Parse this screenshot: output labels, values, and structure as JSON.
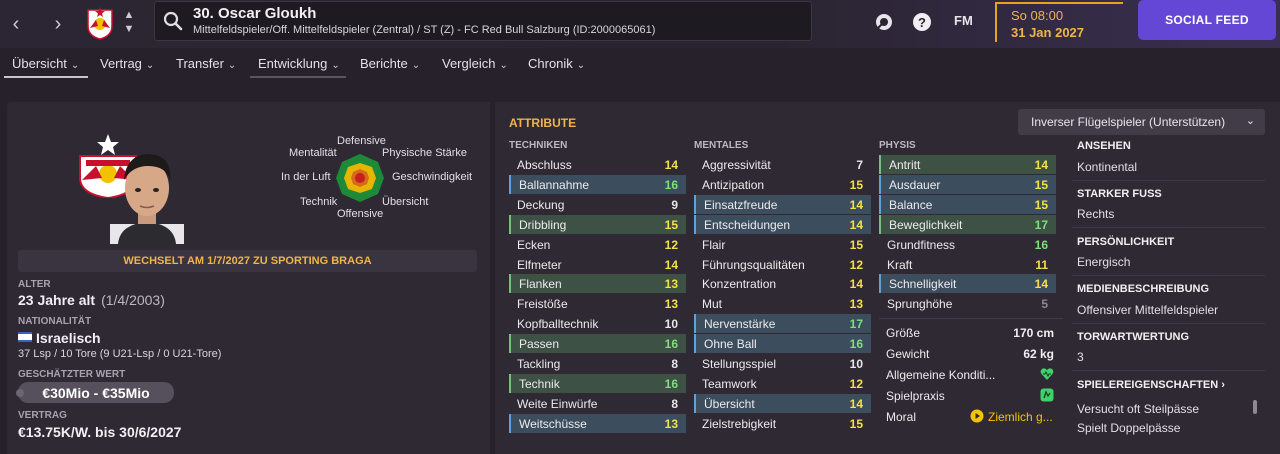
{
  "header": {
    "player_title": "30. Oscar Gloukh",
    "player_subtitle": "Mittelfeldspieler/Off. Mittelfeldspieler (Zentral) / ST (Z) - FC Red Bull Salzburg (ID:2000065061)",
    "fm_label": "FM",
    "date_day": "So 08:00",
    "date_date": "31 Jan 2027",
    "social_feed": "SOCIAL FEED"
  },
  "tabs": [
    {
      "label": "Übersicht"
    },
    {
      "label": "Vertrag"
    },
    {
      "label": "Transfer"
    },
    {
      "label": "Entwicklung"
    },
    {
      "label": "Berichte"
    },
    {
      "label": "Vergleich"
    },
    {
      "label": "Chronik"
    }
  ],
  "radar": {
    "labels": {
      "top": "Defensive",
      "top_left": "Mentalität",
      "top_right": "Physische Stärke",
      "left": "In der Luft",
      "right": "Geschwindigkeit",
      "bottom_left": "Technik",
      "bottom_right": "Übersicht",
      "bottom": "Offensive"
    }
  },
  "transfer_banner": "WECHSELT AM 1/7/2027 ZU SPORTING BRAGA",
  "info_left": {
    "age_label": "ALTER",
    "age_value": "23 Jahre alt",
    "age_dob": "(1/4/2003)",
    "nat_label": "NATIONALITÄT",
    "nat_value": "Israelisch",
    "apps": "37 Lsp / 10 Tore (9 U21-Lsp / 0 U21-Tore)",
    "value_label": "GESCHÄTZTER WERT",
    "value": "€30Mio - €35Mio",
    "contract_label": "VERTRAG",
    "contract_value": "€13.75K/W. bis 30/6/2027"
  },
  "attributes": {
    "title": "ATTRIBUTE",
    "role": "Inverser Flügelspieler (Unterstützen)",
    "tech_head": "TECHNIKEN",
    "mental_head": "MENTALES",
    "phys_head": "PHYSIS",
    "technical": [
      {
        "name": "Abschluss",
        "value": "14",
        "hl": ""
      },
      {
        "name": "Ballannahme",
        "value": "16",
        "hl": "b"
      },
      {
        "name": "Deckung",
        "value": "9",
        "hl": ""
      },
      {
        "name": "Dribbling",
        "value": "15",
        "hl": "g"
      },
      {
        "name": "Ecken",
        "value": "12",
        "hl": ""
      },
      {
        "name": "Elfmeter",
        "value": "14",
        "hl": ""
      },
      {
        "name": "Flanken",
        "value": "13",
        "hl": "g"
      },
      {
        "name": "Freistöße",
        "value": "13",
        "hl": ""
      },
      {
        "name": "Kopfballtechnik",
        "value": "10",
        "hl": ""
      },
      {
        "name": "Passen",
        "value": "16",
        "hl": "g"
      },
      {
        "name": "Tackling",
        "value": "8",
        "hl": ""
      },
      {
        "name": "Technik",
        "value": "16",
        "hl": "g"
      },
      {
        "name": "Weite Einwürfe",
        "value": "8",
        "hl": ""
      },
      {
        "name": "Weitschüsse",
        "value": "13",
        "hl": "b"
      }
    ],
    "mental": [
      {
        "name": "Aggressivität",
        "value": "7",
        "hl": ""
      },
      {
        "name": "Antizipation",
        "value": "15",
        "hl": ""
      },
      {
        "name": "Einsatzfreude",
        "value": "14",
        "hl": "b"
      },
      {
        "name": "Entscheidungen",
        "value": "14",
        "hl": "b"
      },
      {
        "name": "Flair",
        "value": "15",
        "hl": ""
      },
      {
        "name": "Führungsqualitäten",
        "value": "12",
        "hl": ""
      },
      {
        "name": "Konzentration",
        "value": "14",
        "hl": ""
      },
      {
        "name": "Mut",
        "value": "13",
        "hl": ""
      },
      {
        "name": "Nervenstärke",
        "value": "17",
        "hl": "b"
      },
      {
        "name": "Ohne Ball",
        "value": "16",
        "hl": "b"
      },
      {
        "name": "Stellungsspiel",
        "value": "10",
        "hl": ""
      },
      {
        "name": "Teamwork",
        "value": "12",
        "hl": ""
      },
      {
        "name": "Übersicht",
        "value": "14",
        "hl": "b"
      },
      {
        "name": "Zielstrebigkeit",
        "value": "15",
        "hl": ""
      }
    ],
    "physical": [
      {
        "name": "Antritt",
        "value": "14",
        "hl": "g"
      },
      {
        "name": "Ausdauer",
        "value": "15",
        "hl": "b"
      },
      {
        "name": "Balance",
        "value": "15",
        "hl": "b"
      },
      {
        "name": "Beweglichkeit",
        "value": "17",
        "hl": "g"
      },
      {
        "name": "Grundfitness",
        "value": "16",
        "hl": ""
      },
      {
        "name": "Kraft",
        "value": "11",
        "hl": ""
      },
      {
        "name": "Schnelligkeit",
        "value": "14",
        "hl": "b"
      },
      {
        "name": "Sprunghöhe",
        "value": "5",
        "hl": ""
      }
    ],
    "extra": {
      "height_label": "Größe",
      "height_value": "170 cm",
      "weight_label": "Gewicht",
      "weight_value": "62 kg",
      "condition_label": "Allgemeine Konditi...",
      "match_label": "Spielpraxis",
      "morale_label": "Moral",
      "morale_value": "Ziemlich g..."
    }
  },
  "info_right": {
    "reputation_h": "ANSEHEN",
    "reputation_v": "Kontinental",
    "foot_h": "STARKER FUSS",
    "foot_v": "Rechts",
    "personality_h": "PERSÖNLICHKEIT",
    "personality_v": "Energisch",
    "media_h": "MEDIENBESCHREIBUNG",
    "media_v": "Offensiver Mittelfeldspieler",
    "gk_h": "TORWARTWERTUNG",
    "gk_v": "3",
    "traits_h": "SPIELEREIGENSCHAFTEN",
    "traits": [
      "Versucht oft Steilpässe",
      "Spielt Doppelpässe"
    ]
  },
  "colors": {
    "accent": "#f0b44a",
    "social": "#6447d4",
    "highlight_blue": "#3c4e5e",
    "highlight_green": "#3e5145",
    "good": "#7ee07a",
    "mid": "#f4e04a"
  }
}
